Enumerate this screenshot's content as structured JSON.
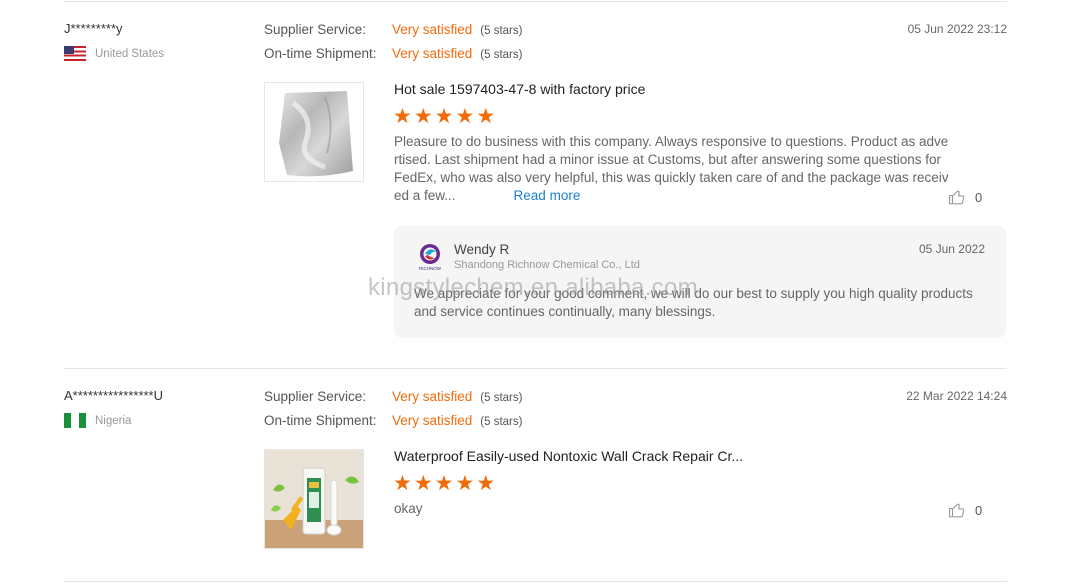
{
  "reviews": [
    {
      "buyer": "J*********y",
      "country": "United States",
      "supplier_service": {
        "label": "Supplier Service:",
        "value": "Very satisfied",
        "stars": "(5 stars)"
      },
      "shipment": {
        "label": "On-time Shipment:",
        "value": "Very satisfied",
        "stars": "(5 stars)"
      },
      "date": "05 Jun 2022 23:12",
      "product_title": "Hot sale 1597403-47-8 with factory price",
      "rating": 5,
      "comment": "Pleasure to do business with this company. Always responsive to questions. Product as advertised. Last shipment had a minor issue at Customs, but after answering some questions for FedEx, who was also very helpful, this was quickly taken care of and the package was received a few...",
      "read_more": "Read more",
      "likes": "0",
      "reply": {
        "name": "Wendy R",
        "company": "Shandong Richnow Chemical Co., Ltd",
        "date": "05 Jun 2022",
        "text": "We appreciate for your good comment, we will do our best to supply you high quality products and service continues continually, many blessings.",
        "logo_text": "RICHNOW"
      }
    },
    {
      "buyer": "A****************U",
      "country": "Nigeria",
      "supplier_service": {
        "label": "Supplier Service:",
        "value": "Very satisfied",
        "stars": "(5 stars)"
      },
      "shipment": {
        "label": "On-time Shipment:",
        "value": "Very satisfied",
        "stars": "(5 stars)"
      },
      "date": "22 Mar 2022 14:24",
      "product_title": "Waterproof Easily-used Nontoxic Wall Crack Repair Cr...",
      "rating": 5,
      "comment": "okay",
      "likes": "0"
    }
  ],
  "watermark": "kingstylechem.en.alibaba.com",
  "colors": {
    "accent": "#f26b0b",
    "link": "#1c7fcf"
  }
}
